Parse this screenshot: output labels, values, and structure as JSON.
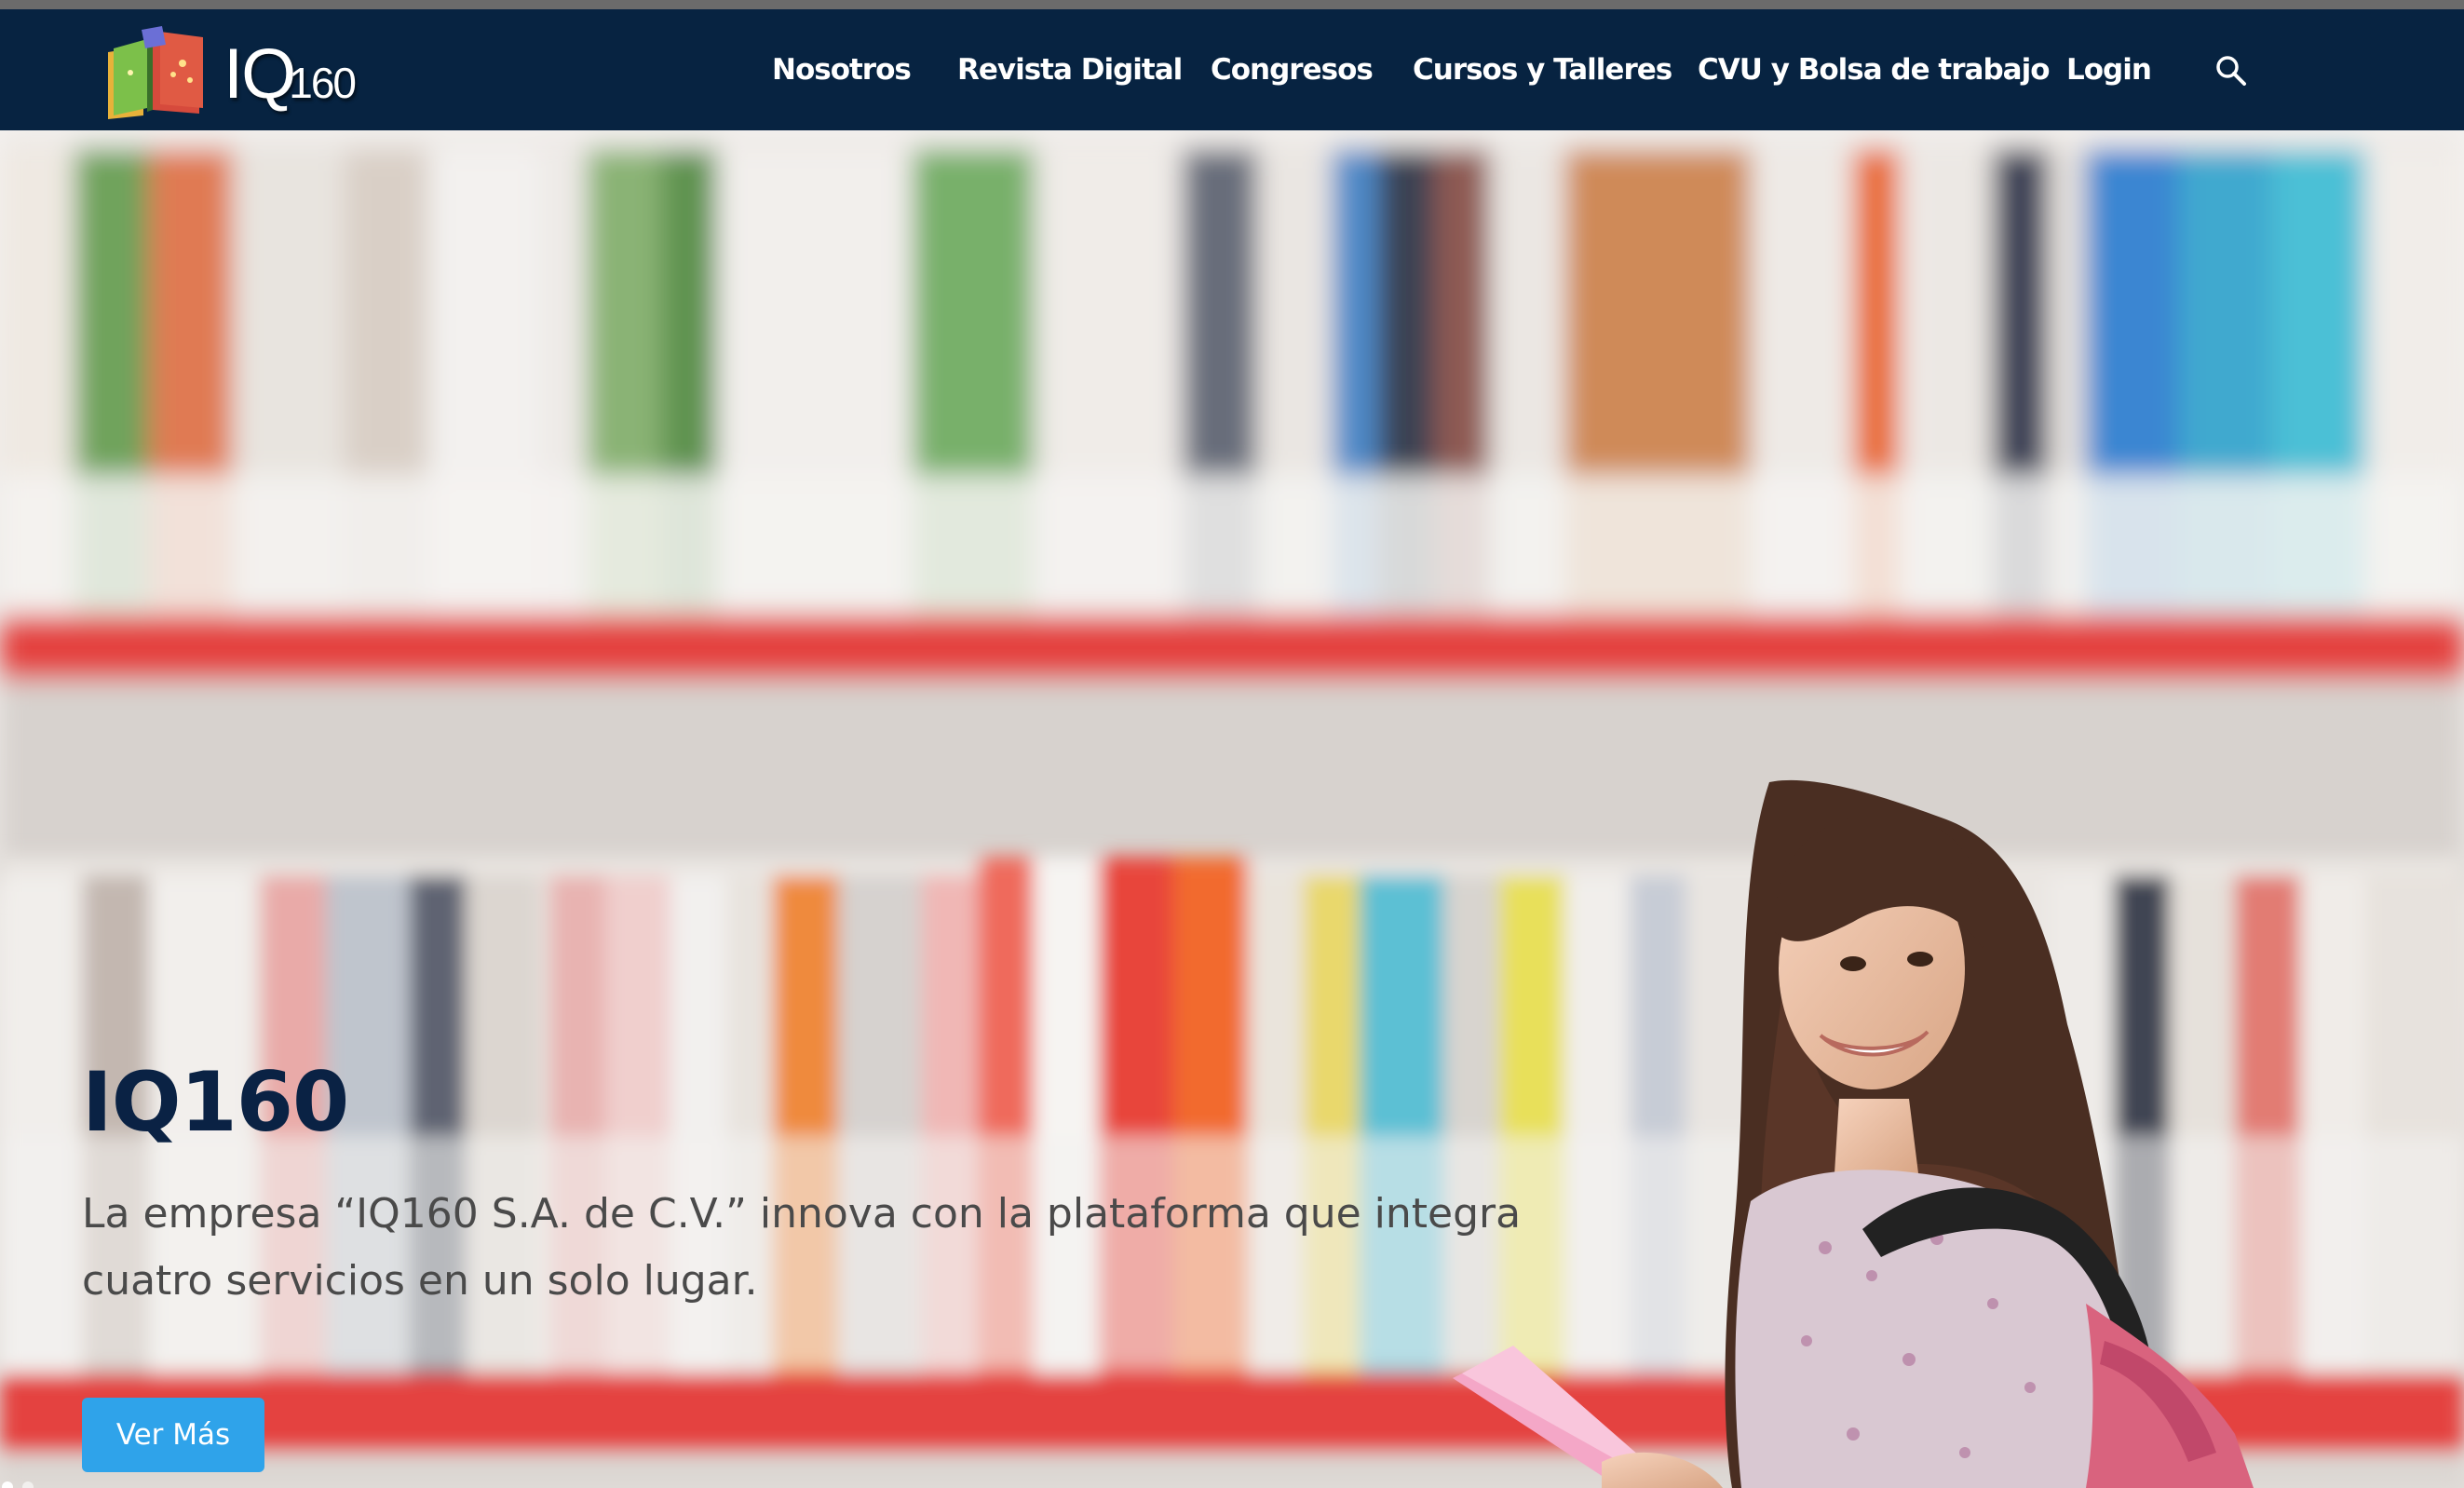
{
  "brand": {
    "logo_text": "IQ",
    "logo_sub": "160"
  },
  "nav": {
    "items": [
      {
        "label": "Nosotros"
      },
      {
        "label": "Revista Digital"
      },
      {
        "label": "Congresos"
      },
      {
        "label": "Cursos y Talleres"
      },
      {
        "label": "CVU y Bolsa de trabajo"
      },
      {
        "label": "Login"
      }
    ]
  },
  "hero": {
    "title": "IQ160",
    "description": "La empresa “IQ160 S.A. de C.V.” innova con la plataforma que integra cuatro servicios en un solo lugar.",
    "button_label": "Ver Más"
  },
  "colors": {
    "navbar": "#072341",
    "accent": "#2fa3ea",
    "title": "#0a2244",
    "shelf": "#e4433f"
  },
  "icons": [
    "logo-books-icon",
    "search-icon"
  ]
}
